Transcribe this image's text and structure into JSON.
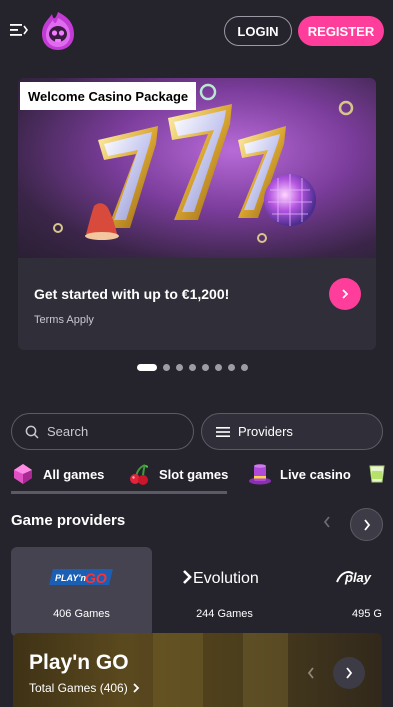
{
  "header": {
    "login_label": "LOGIN",
    "register_label": "REGISTER"
  },
  "promo": {
    "tag": "Welcome Casino Package",
    "title": "Get started with up to €1,200!",
    "terms": "Terms Apply",
    "carousel": {
      "total": 8,
      "active": 1
    }
  },
  "search": {
    "placeholder": "Search"
  },
  "providers_button": {
    "label": "Providers"
  },
  "categories": [
    {
      "label": "All games",
      "icon": "gem-icon"
    },
    {
      "label": "Slot games",
      "icon": "cherry-icon"
    },
    {
      "label": "Live casino",
      "icon": "top-hat-icon"
    }
  ],
  "game_providers": {
    "title": "Game providers",
    "items": [
      {
        "name": "PLAY'n GO",
        "count": "406 Games",
        "selected": true
      },
      {
        "name": "Evolution",
        "count": "244 Games",
        "selected": false
      },
      {
        "name": "play",
        "count": "495 G",
        "selected": false
      }
    ]
  },
  "featured": {
    "title": "Play'n GO",
    "subtitle": "Total Games (406)"
  },
  "colors": {
    "background": "#25232b",
    "accent_pink": "#ff3d9a",
    "card": "#302e38"
  }
}
